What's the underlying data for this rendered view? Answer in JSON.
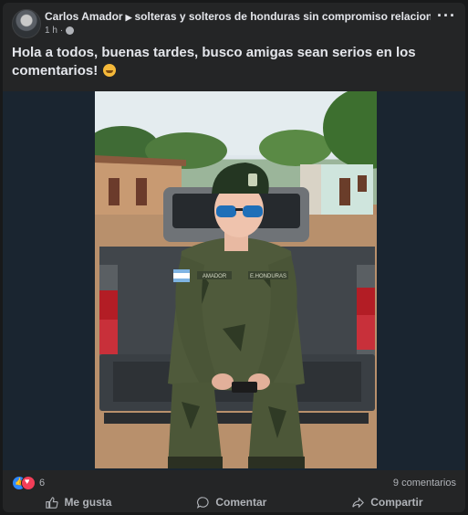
{
  "post": {
    "author": "Carlos Amador",
    "group": "solteras y solteros de honduras sin compromiso relaciones abiertas",
    "time": "1 h",
    "text": "Hola a todos, buenas tardes, busco amigas sean serios en los comentarios!",
    "icons": {
      "audience": "globe-icon",
      "more": "more-options-icon",
      "emoji": "laughing-emoji-icon"
    }
  },
  "image": {
    "uniform_name_tape": "AMADOR",
    "uniform_branch_tape": "E.HONDURAS"
  },
  "stats": {
    "reactions_count": "6",
    "comments_count": "9 comentarios"
  },
  "actions": {
    "like": "Me gusta",
    "comment": "Comentar",
    "share": "Compartir"
  },
  "colors": {
    "card": "#242526",
    "text": "#e4e6eb",
    "secondary": "#b0b3b8",
    "like_blue": "#2d88ff",
    "love_red": "#f33e58"
  }
}
